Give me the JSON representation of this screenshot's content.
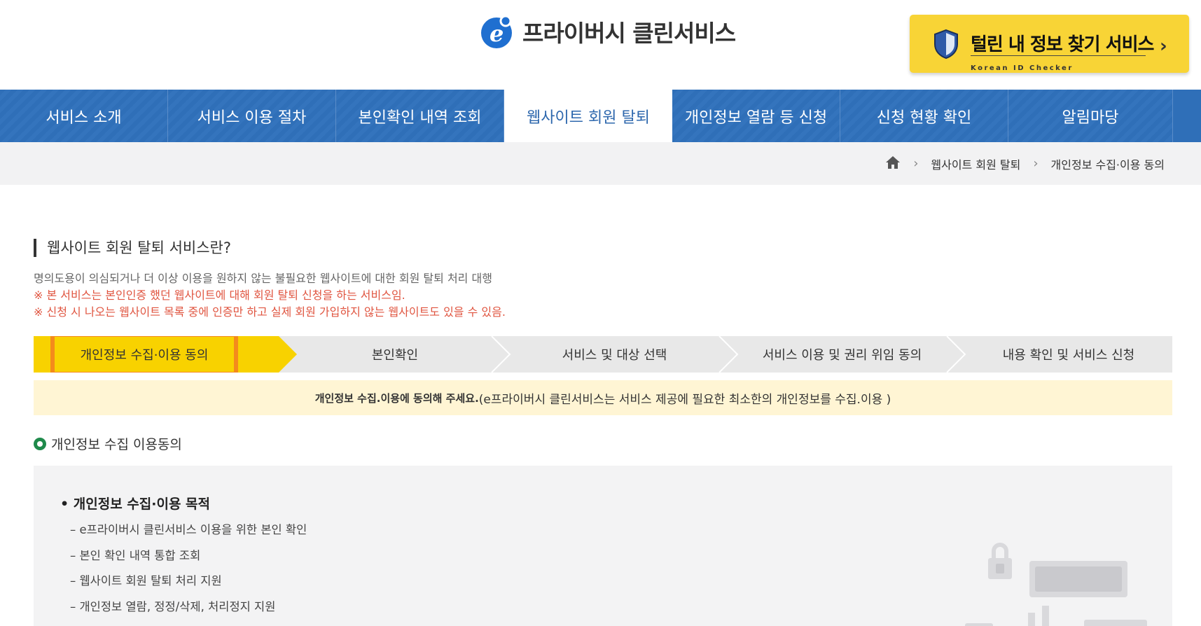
{
  "header": {
    "logo_letter": "e",
    "logo_text": "프라이버시 클린서비스",
    "promo": {
      "title": "털린 내 정보 찾기 서비스",
      "subtitle": "Korean ID Checker",
      "arrow": "›"
    }
  },
  "nav": {
    "items": [
      {
        "label": "서비스 소개"
      },
      {
        "label": "서비스 이용 절차"
      },
      {
        "label": "본인확인 내역 조회"
      },
      {
        "label": "웹사이트 회원 탈퇴"
      },
      {
        "label": "개인정보 열람 등 신청"
      },
      {
        "label": "신청 현황 확인"
      },
      {
        "label": "알림마당"
      }
    ],
    "active_index": 3
  },
  "breadcrumb": {
    "items": [
      "웹사이트 회원 탈퇴",
      "개인정보 수집·이용 동의"
    ]
  },
  "section": {
    "title": "웹사이트 회원 탈퇴 서비스란?",
    "description": "명의도용이 의심되거나 더 이상 이용을 원하지 않는 불필요한 웹사이트에 대한 회원 탈퇴 처리 대행",
    "notes": [
      "※ 본 서비스는 본인인증 했던 웹사이트에 대해 회원 탈퇴 신청을 하는 서비스임.",
      "※ 신청 시 나오는 웹사이트 목록 중에 인증만 하고 실제 회원 가입하지 않는 웹사이트도 있을 수 있음."
    ]
  },
  "steps": {
    "items": [
      {
        "label": "개인정보 수집·이용 동의"
      },
      {
        "label": "본인확인"
      },
      {
        "label": "서비스 및 대상 선택"
      },
      {
        "label": "서비스 이용 및 권리 위임 동의"
      },
      {
        "label": "내용 확인 및 서비스 신청"
      }
    ],
    "active_index": 0
  },
  "notice": {
    "bold": "개인정보 수집.이용에 동의해 주세요.",
    "text": "(e프라이버시 클린서비스는 서비스 제공에 필요한 최소한의 개인정보를 수집.이용 )"
  },
  "consent": {
    "title": "개인정보 수집 이용동의",
    "purpose_title": "• 개인정보 수집·이용 목적",
    "purposes": [
      "– e프라이버시 클린서비스 이용을 위한 본인 확인",
      "– 본인 확인 내역 통합 조회",
      "– 웹사이트 회원 탈퇴 처리 지원",
      "– 개인정보 열람, 정정/삭제, 처리정지 지원"
    ]
  },
  "colors": {
    "nav_blue": "#2f6fb8",
    "active_step": "#f8d200",
    "highlight_border": "#f48a1c",
    "note_red": "#e05540",
    "notice_bg": "#fff5d4"
  }
}
